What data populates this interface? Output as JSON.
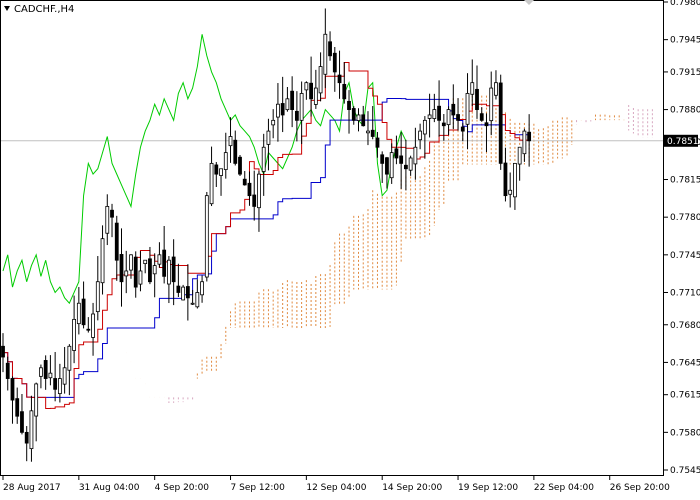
{
  "chart_data": {
    "type": "candlestick",
    "title": "CADCHF.,H4",
    "symbol": "CADCHF.",
    "timeframe": "H4",
    "current_price": "0.7851",
    "ylim": [
      0.7545,
      0.798
    ],
    "y_ticks": [
      "0.7980",
      "0.7945",
      "0.7915",
      "0.7880",
      "0.7850",
      "0.7815",
      "0.7780",
      "0.7745",
      "0.7710",
      "0.7680",
      "0.7645",
      "0.7615",
      "0.7580",
      "0.7545"
    ],
    "y_tick_values": [
      0.798,
      0.7945,
      0.7915,
      0.788,
      0.785,
      0.7815,
      0.778,
      0.7745,
      0.771,
      0.768,
      0.7645,
      0.7615,
      0.758,
      0.7545
    ],
    "x_labels": [
      "28 Aug 2017",
      "31 Aug 04:00",
      "4 Sep 20:00",
      "7 Sep 12:00",
      "12 Sep 04:00",
      "14 Sep 20:00",
      "19 Sep 12:00",
      "22 Sep 04:00",
      "26 Sep 20:00"
    ],
    "x_label_bars": [
      0,
      16,
      32,
      48,
      64,
      80,
      96,
      112,
      128
    ],
    "series": [
      {
        "name": "candles",
        "closes": [
          0.765,
          0.763,
          0.761,
          0.7595,
          0.758,
          0.757,
          0.76,
          0.7625,
          0.764,
          0.763,
          0.7635,
          0.762,
          0.763,
          0.764,
          0.766,
          0.7685,
          0.77,
          0.768,
          0.7675,
          0.769,
          0.772,
          0.776,
          0.779,
          0.778,
          0.774,
          0.772,
          0.773,
          0.7745,
          0.7715,
          0.773,
          0.774,
          0.772,
          0.7735,
          0.7745,
          0.7725,
          0.774,
          0.772,
          0.771,
          0.7715,
          0.7705,
          0.77,
          0.771,
          0.772,
          0.78,
          0.783,
          0.782,
          0.7825,
          0.784,
          0.7855,
          0.783,
          0.782,
          0.781,
          0.78,
          0.779,
          0.782,
          0.7845,
          0.786,
          0.787,
          0.7885,
          0.7875,
          0.789,
          0.788,
          0.787,
          0.7895,
          0.7905,
          0.789,
          0.79,
          0.792,
          0.795,
          0.793,
          0.7915,
          0.7905,
          0.789,
          0.788,
          0.787,
          0.7875,
          0.7865,
          0.786,
          0.7855,
          0.7845,
          0.783,
          0.782,
          0.784,
          0.7835,
          0.783,
          0.7825,
          0.7835,
          0.7845,
          0.786,
          0.787,
          0.7875,
          0.788,
          0.787,
          0.7865,
          0.788,
          0.7875,
          0.787,
          0.786,
          0.7895,
          0.7905,
          0.788,
          0.787,
          0.7865,
          0.79,
          0.7905,
          0.783,
          0.78,
          0.7805,
          0.783,
          0.7845,
          0.786,
          0.7851
        ],
        "opens": null
      },
      {
        "name": "tenkan",
        "color": "#cc0000"
      },
      {
        "name": "kijun",
        "color": "#0000cc"
      },
      {
        "name": "chikou",
        "color": "#00cc00"
      },
      {
        "name": "cloud-a",
        "color": "#e08a40"
      },
      {
        "name": "cloud-b",
        "color": "#d8a8c0"
      }
    ]
  },
  "colors": {
    "background": "#ffffff",
    "axis": "#000000",
    "candle": "#000000",
    "tenkan": "#cc0000",
    "kijun": "#0000cc",
    "chikou": "#00cc00",
    "cloud_up": "#e08a40",
    "cloud_down": "#d8a8c0",
    "price_line": "#c0c0c0",
    "price_box": "#000000"
  },
  "icons": {
    "title_arrow": "triangle-down-icon",
    "scroll_marker": "triangle-down-icon"
  }
}
